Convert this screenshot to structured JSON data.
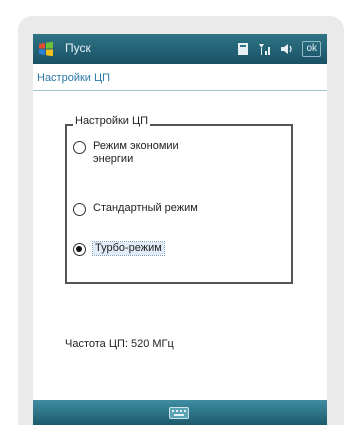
{
  "window": {
    "title": "Пуск",
    "ok_label": "ok"
  },
  "page": {
    "header": "Настройки ЦП"
  },
  "cpu_settings": {
    "legend": "Настройки ЦП",
    "options": [
      {
        "label": "Режим экономии энергии",
        "checked": false
      },
      {
        "label": "Стандартный режим",
        "checked": false
      },
      {
        "label": "Турбо-режим",
        "checked": true
      }
    ]
  },
  "frequency": {
    "text": "Частота ЦП:  520 МГц"
  },
  "colors": {
    "titlebar": "#1a5164",
    "header_text": "#2a7aa8",
    "softbar": "#2d7488"
  },
  "icons": [
    "windows-start-icon",
    "contacts-icon",
    "signal-icon",
    "volume-icon",
    "keyboard-icon"
  ]
}
